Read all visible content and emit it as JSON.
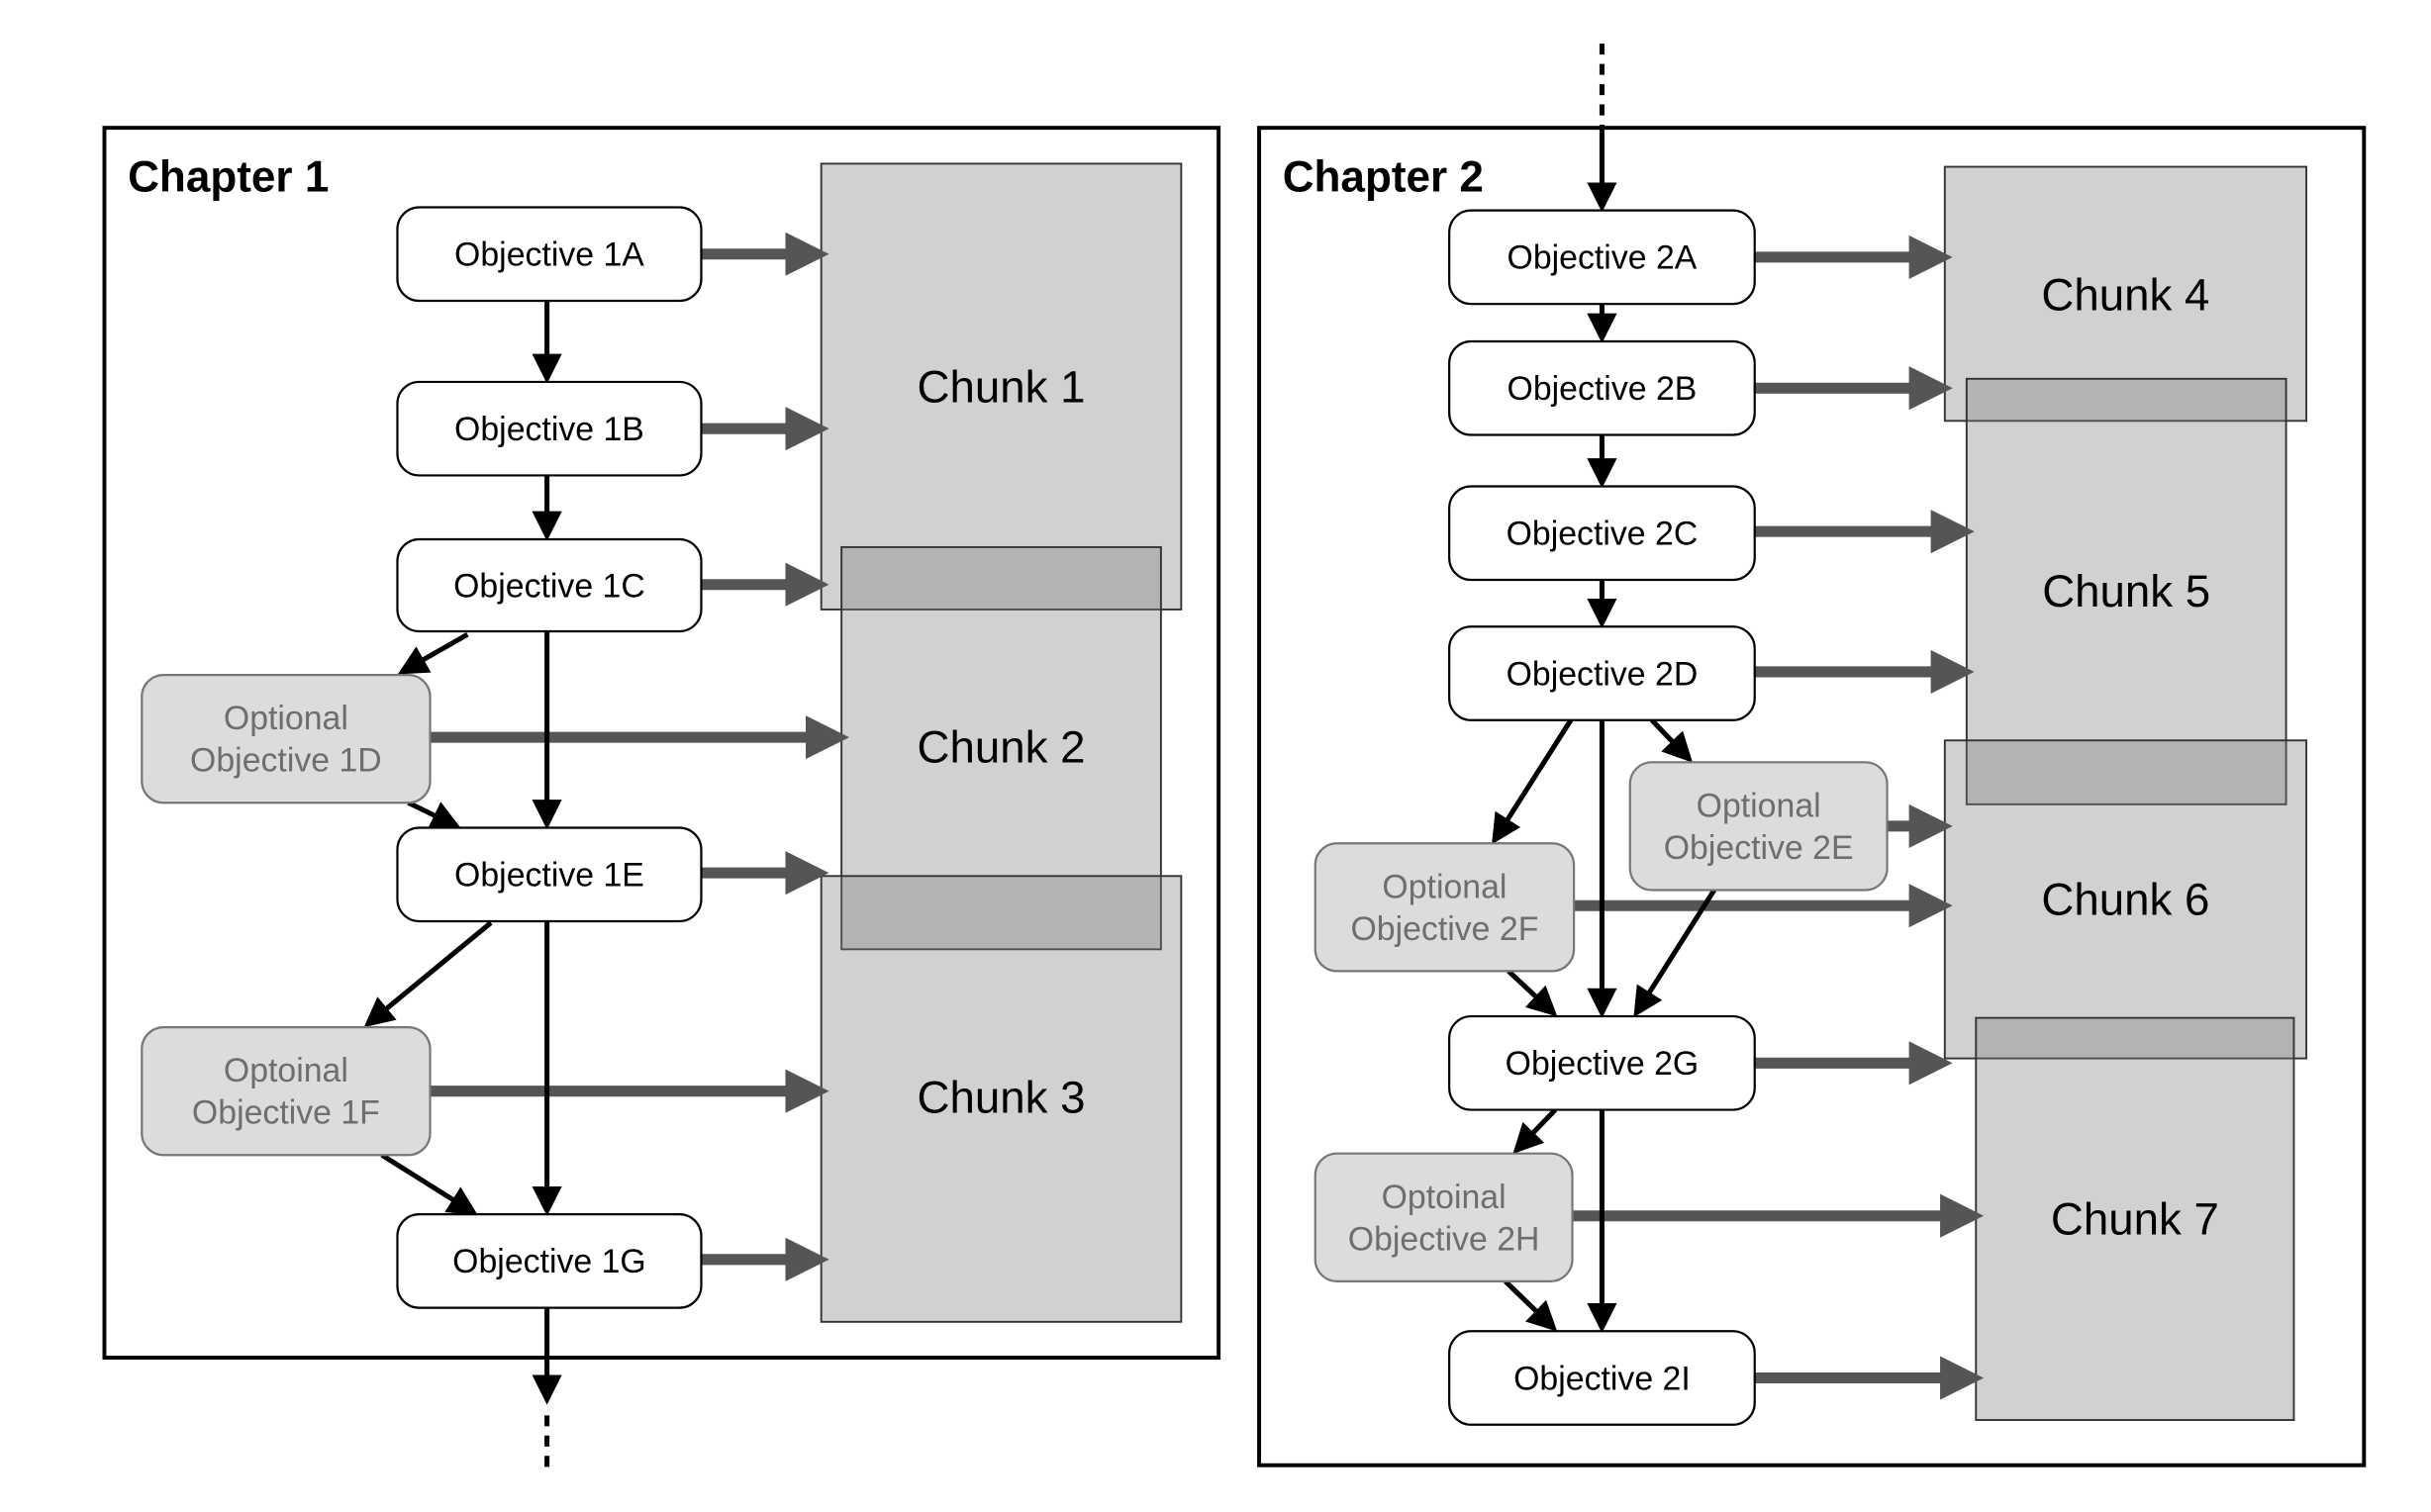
{
  "chapters": [
    {
      "title": "Chapter 1",
      "objectives": {
        "1A": {
          "label": "Objective 1A",
          "optional": false
        },
        "1B": {
          "label": "Objective 1B",
          "optional": false
        },
        "1C": {
          "label": "Objective 1C",
          "optional": false
        },
        "1D": {
          "label": [
            "Optional",
            "Objective 1D"
          ],
          "optional": true
        },
        "1E": {
          "label": "Objective 1E",
          "optional": false
        },
        "1F": {
          "label": [
            "Optoinal",
            "Objective 1F"
          ],
          "optional": true
        },
        "1G": {
          "label": "Objective 1G",
          "optional": false
        }
      },
      "chunks": {
        "c1": "Chunk 1",
        "c2": "Chunk 2",
        "c3": "Chunk 3"
      }
    },
    {
      "title": "Chapter 2",
      "objectives": {
        "2A": {
          "label": "Objective 2A",
          "optional": false
        },
        "2B": {
          "label": "Objective 2B",
          "optional": false
        },
        "2C": {
          "label": "Objective 2C",
          "optional": false
        },
        "2D": {
          "label": "Objective 2D",
          "optional": false
        },
        "2E": {
          "label": [
            "Optional",
            "Objective 2E"
          ],
          "optional": true
        },
        "2F": {
          "label": [
            "Optional",
            "Objective 2F"
          ],
          "optional": true
        },
        "2G": {
          "label": "Objective 2G",
          "optional": false
        },
        "2H": {
          "label": [
            "Optoinal",
            "Objective 2H"
          ],
          "optional": true
        },
        "2I": {
          "label": "Objective 2I",
          "optional": false
        }
      },
      "chunks": {
        "c4": "Chunk 4",
        "c5": "Chunk 5",
        "c6": "Chunk 6",
        "c7": "Chunk 7"
      }
    }
  ],
  "colors": {
    "objective_fill": "#ffffff",
    "optional_fill": "#dcdcdc",
    "optional_text": "#6e6e6e",
    "chunk_fill": "#808080",
    "flow_arrow": "#000000",
    "content_arrow": "#555555"
  }
}
